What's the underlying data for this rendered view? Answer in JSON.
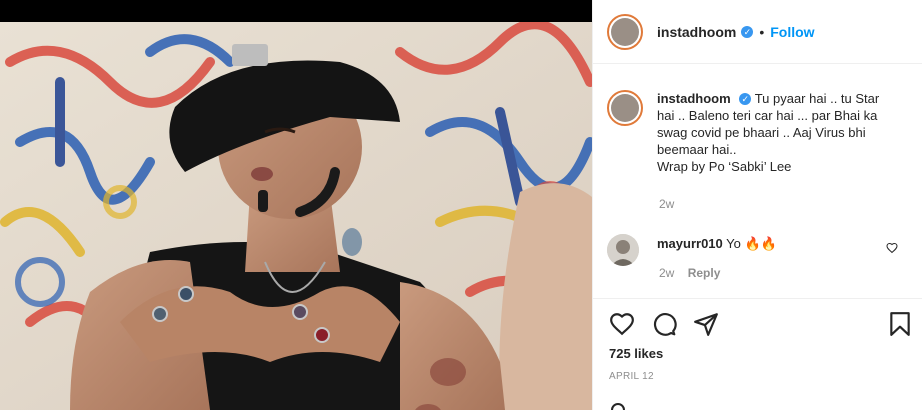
{
  "post": {
    "author": "instadhoom",
    "separator": "•",
    "follow_label": "Follow",
    "verified_mark": "✓",
    "caption_lines": [
      "Tu pyaar hai .. tu Star",
      "hai .. Baleno teri car hai ... par Bhai ka",
      "swag covid pe bhaari .. Aaj Virus bhi",
      "beemaar hai..",
      "Wrap by Po ‘Sabki’ Lee"
    ],
    "caption_time": "2w"
  },
  "comment": {
    "user": "mayurr010",
    "text": "Yo 🔥🔥",
    "time": "2w",
    "reply_label": "Reply"
  },
  "actions": {
    "likes": "725 likes",
    "date": "APRIL 12",
    "icons": [
      "heart-icon",
      "comment-icon",
      "share-icon",
      "bookmark-icon"
    ]
  },
  "colors": {
    "accent": "#0095f6",
    "verified": "#3897f0",
    "text": "#262626",
    "muted": "#8e8e8e",
    "border": "#efefef"
  }
}
